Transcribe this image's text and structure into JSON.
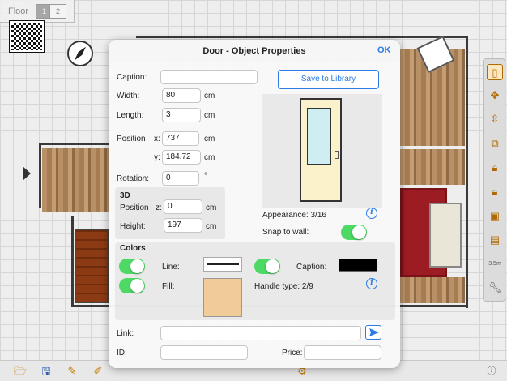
{
  "floor_selector": {
    "label": "Floor",
    "floors": [
      "1",
      "2"
    ],
    "active_floor": "1"
  },
  "dialog": {
    "title": "Door - Object Properties",
    "ok_label": "OK",
    "caption": {
      "label": "Caption:",
      "value": ""
    },
    "save_to_library_label": "Save to Library",
    "width": {
      "label": "Width:",
      "value": "80",
      "unit": "cm"
    },
    "length": {
      "label": "Length:",
      "value": "3",
      "unit": "cm"
    },
    "position": {
      "label": "Position",
      "x_label": "x:",
      "x_value": "737",
      "x_unit": "cm",
      "y_label": "y:",
      "y_value": "184.72",
      "y_unit": "cm"
    },
    "rotation": {
      "label": "Rotation:",
      "value": "0",
      "unit": "°"
    },
    "three_d": {
      "heading": "3D",
      "position_label": "Position",
      "z_label": "z:",
      "z_value": "0",
      "z_unit": "cm",
      "height_label": "Height:",
      "height_value": "197",
      "height_unit": "cm"
    },
    "appearance": "Appearance: 3/16",
    "snap_to_wall": {
      "label": "Snap to wall:",
      "on": true
    },
    "colors": {
      "heading": "Colors",
      "line_label": "Line:",
      "line_on": true,
      "line_color": "#222222",
      "fill_label": "Fill:",
      "fill_on": true,
      "fill_color": "#f1cc99",
      "caption_label": "Caption:",
      "caption_on": true,
      "caption_color": "#000000",
      "handle_type": "Handle type: 2/9"
    },
    "link": {
      "label": "Link:",
      "value": ""
    },
    "id": {
      "label": "ID:",
      "value": ""
    },
    "price": {
      "label": "Price:",
      "value": ""
    }
  },
  "colors": {
    "accent": "#2a7be4",
    "toggle_on": "#4cd964"
  },
  "icons": {
    "right_toolbar": [
      "door-type-icon",
      "move-icon",
      "align-icon",
      "duplicate-icon",
      "lock-icon",
      "lock-all-icon",
      "stack-icon",
      "group-icon",
      "dimension-icon",
      "wrench-icon"
    ],
    "bottom_toolbar": [
      "open-folder-icon",
      "save-icon",
      "info-icon"
    ]
  }
}
